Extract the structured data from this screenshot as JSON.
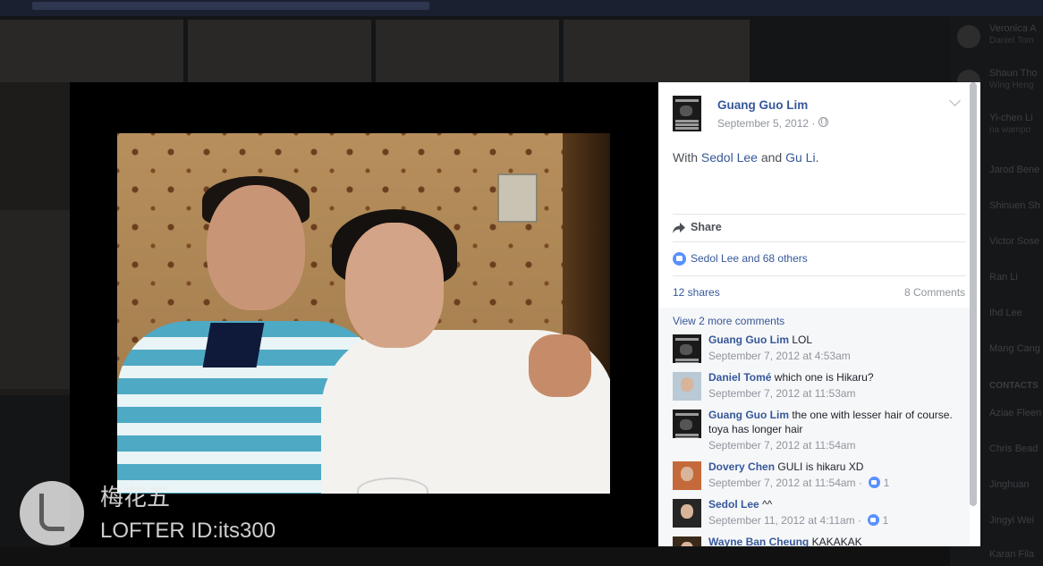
{
  "post": {
    "author": "Guang Guo Lim",
    "date": "September 5, 2012 · ",
    "text_prefix": "With ",
    "tagged_1": "Sedol Lee",
    "text_and": " and ",
    "tagged_2": "Gu Li",
    "text_suffix": ".",
    "share_label": "Share",
    "likes": "Sedol Lee and 68 others",
    "shares": "12 shares",
    "comments_count": "8 Comments",
    "view_more": "View 2 more comments"
  },
  "comments": [
    {
      "author": "Guang Guo Lim",
      "text": " LOL",
      "meta": "September 7, 2012 at 4:53am",
      "likes": ""
    },
    {
      "author": "Daniel Tomé",
      "text": " which one is Hikaru?",
      "meta": "September 7, 2012 at 11:53am",
      "likes": ""
    },
    {
      "author": "Guang Guo Lim",
      "text": " the one with lesser hair of course. toya has longer hair",
      "meta": "September 7, 2012 at 11:54am",
      "likes": ""
    },
    {
      "author": "Dovery Chen",
      "text": " GULI is hikaru XD",
      "meta": "September 7, 2012 at 11:54am · ",
      "likes": "1"
    },
    {
      "author": "Sedol Lee",
      "text": " ^^",
      "meta": "September 11, 2012 at 4:11am · ",
      "likes": "1"
    },
    {
      "author": "Wayne Ban Cheung",
      "text": " KAKAKAK",
      "meta": "",
      "likes": ""
    }
  ],
  "watermark": {
    "name": "梅花五",
    "id": "LOFTER ID:its300"
  },
  "sidebar": {
    "items": [
      {
        "name": "Veronica A",
        "sub": "Daniel Tom"
      },
      {
        "name": "Shaun Tho",
        "sub": "Wing Heng"
      },
      {
        "name": "Yi-chen Li",
        "sub": "na wampo"
      },
      {
        "name": "Jarod Bene",
        "sub": ""
      },
      {
        "name": "Shinuen Sh",
        "sub": ""
      },
      {
        "name": "Victor Sose",
        "sub": ""
      },
      {
        "name": "Ran Li",
        "sub": ""
      },
      {
        "name": "Ihd Lee",
        "sub": ""
      },
      {
        "name": "Mang Cang",
        "sub": ""
      },
      {
        "name": "Aziae Fleen",
        "sub": ""
      },
      {
        "name": "Chris Bead",
        "sub": ""
      },
      {
        "name": "Jinghuan",
        "sub": ""
      },
      {
        "name": "Jingyi Wei",
        "sub": ""
      },
      {
        "name": "Karan Fila",
        "sub": ""
      }
    ],
    "section_label": "CONTACTS"
  }
}
